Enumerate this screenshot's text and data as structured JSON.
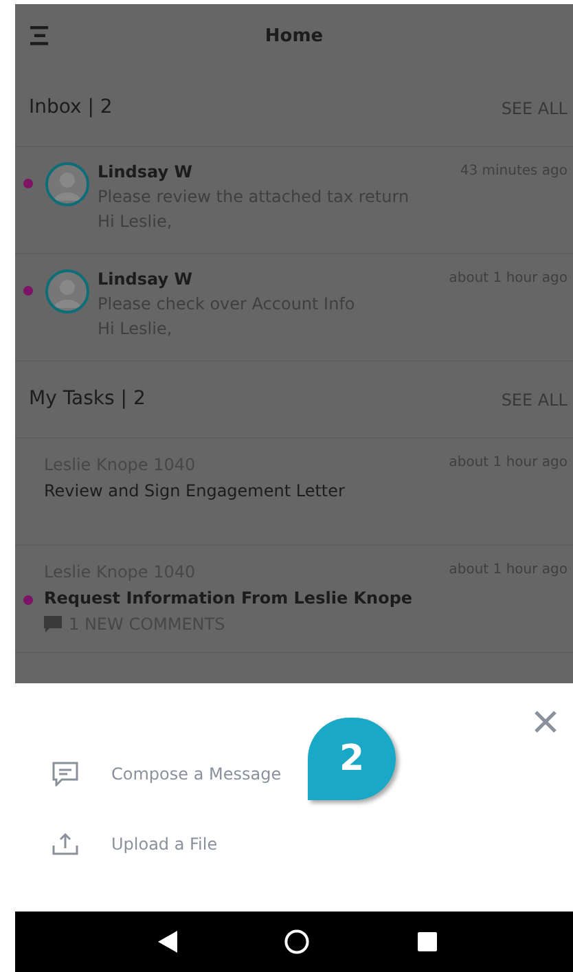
{
  "header": {
    "title": "Home"
  },
  "inbox": {
    "title": "Inbox | 2",
    "see_all": "SEE ALL",
    "messages": [
      {
        "sender": "Lindsay W",
        "subject": "Please review the attached tax return",
        "preview": "Hi Leslie,",
        "time": "43 minutes ago",
        "unread": true
      },
      {
        "sender": "Lindsay W",
        "subject": "Please check over Account Info",
        "preview": "Hi Leslie,",
        "time": "about 1 hour ago",
        "unread": true
      }
    ]
  },
  "tasks": {
    "title": "My Tasks | 2",
    "see_all": "SEE ALL",
    "items": [
      {
        "client": "Leslie Knope 1040",
        "title": "Review and Sign Engagement Letter",
        "time": "about 1 hour ago",
        "unread": false
      },
      {
        "client": "Leslie Knope 1040",
        "title": "Request Information From Leslie Knope",
        "time": "about 1 hour ago",
        "unread": true,
        "comments": "1 NEW COMMENTS"
      }
    ]
  },
  "sheet": {
    "actions": [
      {
        "kind": "message",
        "label": "Compose a Message"
      },
      {
        "kind": "upload",
        "label": "Upload a File"
      }
    ],
    "step_badge": "2"
  }
}
